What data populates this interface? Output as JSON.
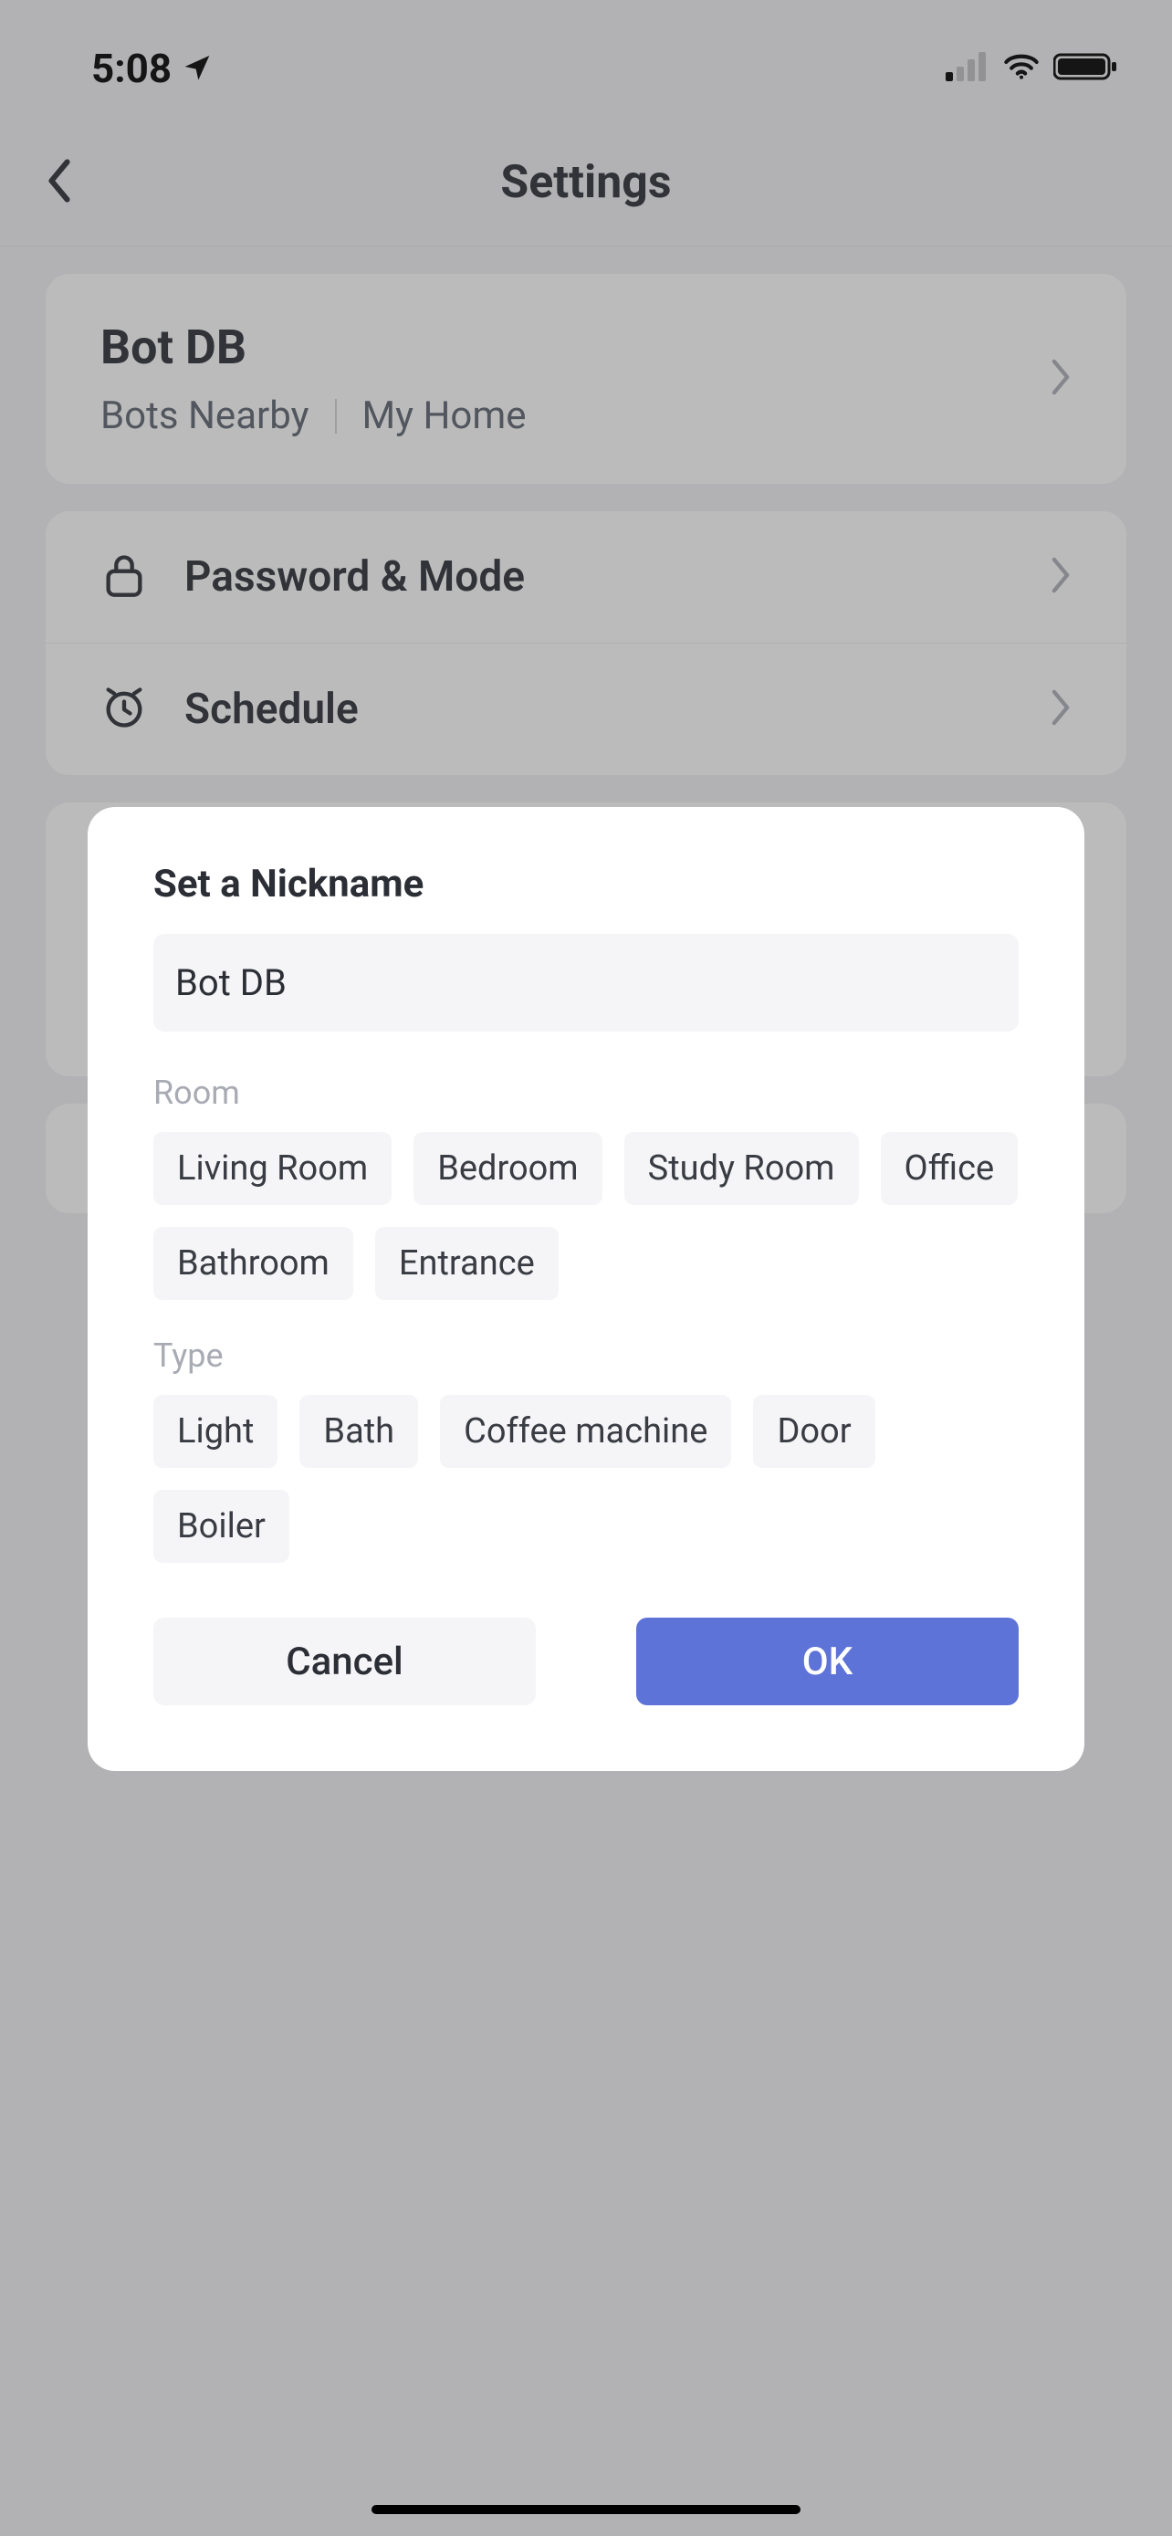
{
  "status": {
    "time": "5:08"
  },
  "nav": {
    "title": "Settings"
  },
  "device": {
    "name": "Bot DB",
    "sub1": "Bots Nearby",
    "sub2": "My Home"
  },
  "rows": {
    "password": "Password & Mode",
    "schedule": "Schedule"
  },
  "dialog": {
    "title": "Set a Nickname",
    "input_value": "Bot DB",
    "room_label": "Room",
    "type_label": "Type",
    "rooms": [
      "Living Room",
      "Bedroom",
      "Study Room",
      "Office",
      "Bathroom",
      "Entrance"
    ],
    "types": [
      "Light",
      "Bath",
      "Coffee machine",
      "Door",
      "Boiler"
    ],
    "cancel": "Cancel",
    "ok": "OK"
  }
}
